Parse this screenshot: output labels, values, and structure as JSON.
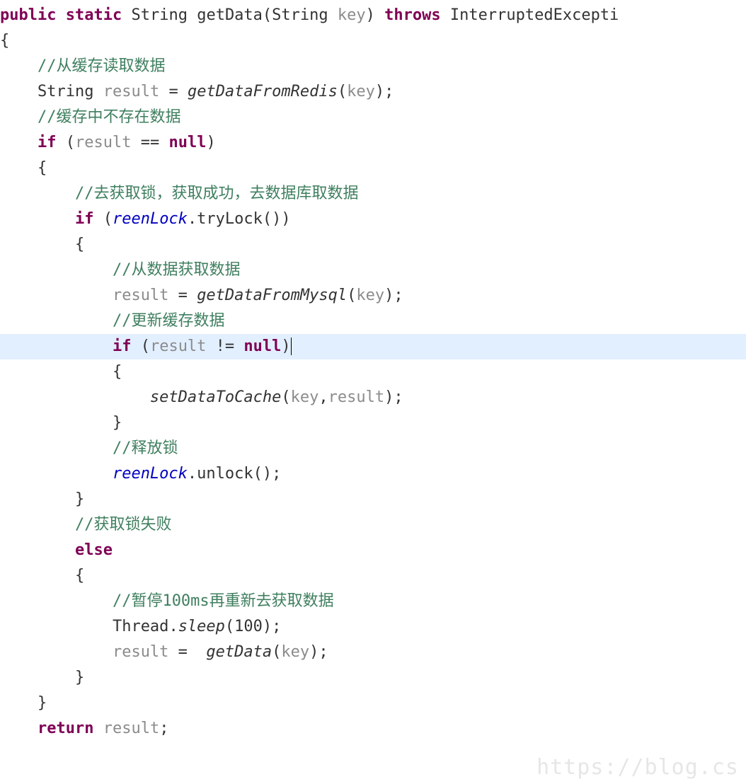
{
  "code": {
    "lines": [
      {
        "indent": 0,
        "segments": [
          {
            "cls": "kw",
            "t": "public"
          },
          {
            "t": " "
          },
          {
            "cls": "kw",
            "t": "static"
          },
          {
            "t": " "
          },
          {
            "cls": "typ",
            "t": "String"
          },
          {
            "t": " "
          },
          {
            "cls": "typ",
            "t": "getData"
          },
          {
            "t": "("
          },
          {
            "cls": "typ",
            "t": "String"
          },
          {
            "t": " "
          },
          {
            "cls": "var",
            "t": "key"
          },
          {
            "t": ") "
          },
          {
            "cls": "kw",
            "t": "throws"
          },
          {
            "t": " "
          },
          {
            "cls": "typ",
            "t": "InterruptedExcepti"
          }
        ]
      },
      {
        "indent": 0,
        "segments": [
          {
            "t": "{"
          }
        ]
      },
      {
        "indent": 1,
        "segments": [
          {
            "cls": "cmt",
            "t": "//从缓存读取数据"
          }
        ]
      },
      {
        "indent": 1,
        "segments": [
          {
            "cls": "typ",
            "t": "String"
          },
          {
            "t": " "
          },
          {
            "cls": "var",
            "t": "result"
          },
          {
            "t": " = "
          },
          {
            "cls": "ital",
            "t": "getDataFromRedis"
          },
          {
            "t": "("
          },
          {
            "cls": "var",
            "t": "key"
          },
          {
            "t": ");"
          }
        ]
      },
      {
        "indent": 1,
        "segments": [
          {
            "cls": "cmt",
            "t": "//缓存中不存在数据"
          }
        ]
      },
      {
        "indent": 1,
        "segments": [
          {
            "cls": "kw",
            "t": "if"
          },
          {
            "t": " ("
          },
          {
            "cls": "var",
            "t": "result"
          },
          {
            "t": " == "
          },
          {
            "cls": "kw",
            "t": "null"
          },
          {
            "t": ")"
          }
        ]
      },
      {
        "indent": 1,
        "segments": [
          {
            "t": "{"
          }
        ]
      },
      {
        "indent": 2,
        "segments": [
          {
            "cls": "cmt",
            "t": "//去获取锁，获取成功，去数据库取数据"
          }
        ]
      },
      {
        "indent": 2,
        "segments": [
          {
            "cls": "kw",
            "t": "if"
          },
          {
            "t": " ("
          },
          {
            "cls": "italblue",
            "t": "reenLock"
          },
          {
            "t": ".tryLock())"
          }
        ]
      },
      {
        "indent": 2,
        "segments": [
          {
            "t": "{"
          }
        ]
      },
      {
        "indent": 3,
        "segments": [
          {
            "cls": "cmt",
            "t": "//从数据获取数据"
          }
        ]
      },
      {
        "indent": 3,
        "segments": [
          {
            "cls": "var",
            "t": "result"
          },
          {
            "t": " = "
          },
          {
            "cls": "ital",
            "t": "getDataFromMysql"
          },
          {
            "t": "("
          },
          {
            "cls": "var",
            "t": "key"
          },
          {
            "t": ");"
          }
        ]
      },
      {
        "indent": 3,
        "segments": [
          {
            "cls": "cmt",
            "t": "//更新缓存数据"
          }
        ]
      },
      {
        "indent": 3,
        "highlight": true,
        "segments": [
          {
            "cls": "kw",
            "t": "if"
          },
          {
            "t": " ("
          },
          {
            "cls": "var",
            "t": "result"
          },
          {
            "t": " != "
          },
          {
            "cls": "kw",
            "t": "null"
          },
          {
            "t": ")"
          },
          {
            "cls": "caret",
            "t": ""
          }
        ]
      },
      {
        "indent": 3,
        "segments": [
          {
            "t": "{"
          }
        ]
      },
      {
        "indent": 4,
        "segments": [
          {
            "cls": "ital",
            "t": "setDataToCache"
          },
          {
            "t": "("
          },
          {
            "cls": "var",
            "t": "key"
          },
          {
            "t": ","
          },
          {
            "cls": "var",
            "t": "result"
          },
          {
            "t": ");"
          }
        ]
      },
      {
        "indent": 3,
        "segments": [
          {
            "t": "}"
          }
        ]
      },
      {
        "indent": 3,
        "segments": [
          {
            "cls": "cmt",
            "t": "//释放锁"
          }
        ]
      },
      {
        "indent": 3,
        "segments": [
          {
            "cls": "italblue",
            "t": "reenLock"
          },
          {
            "t": ".unlock();"
          }
        ]
      },
      {
        "indent": 2,
        "segments": [
          {
            "t": "}"
          }
        ]
      },
      {
        "indent": 2,
        "segments": [
          {
            "cls": "cmt",
            "t": "//获取锁失败"
          }
        ]
      },
      {
        "indent": 2,
        "segments": [
          {
            "cls": "kw",
            "t": "else"
          }
        ]
      },
      {
        "indent": 2,
        "segments": [
          {
            "t": "{"
          }
        ]
      },
      {
        "indent": 3,
        "segments": [
          {
            "cls": "cmt",
            "t": "//暂停100ms再重新去获取数据"
          }
        ]
      },
      {
        "indent": 3,
        "segments": [
          {
            "cls": "typ",
            "t": "Thread"
          },
          {
            "t": "."
          },
          {
            "cls": "ital",
            "t": "sleep"
          },
          {
            "t": "("
          },
          {
            "cls": "num",
            "t": "100"
          },
          {
            "t": ");"
          }
        ]
      },
      {
        "indent": 3,
        "segments": [
          {
            "cls": "var",
            "t": "result"
          },
          {
            "t": " =  "
          },
          {
            "cls": "ital",
            "t": "getData"
          },
          {
            "t": "("
          },
          {
            "cls": "var",
            "t": "key"
          },
          {
            "t": ");"
          }
        ]
      },
      {
        "indent": 2,
        "segments": [
          {
            "t": "}"
          }
        ]
      },
      {
        "indent": 1,
        "segments": [
          {
            "t": "}"
          }
        ]
      },
      {
        "indent": 1,
        "segments": [
          {
            "cls": "kw",
            "t": "return"
          },
          {
            "t": " "
          },
          {
            "cls": "var",
            "t": "result"
          },
          {
            "t": ";"
          }
        ]
      }
    ],
    "indent_unit": "    "
  },
  "watermark": "https://blog.cs"
}
